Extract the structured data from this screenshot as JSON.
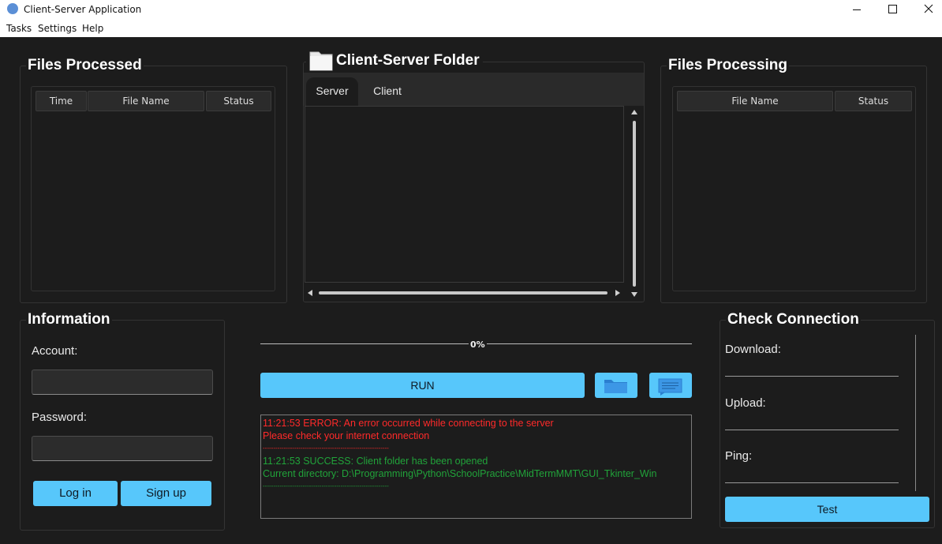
{
  "window": {
    "title": "Client-Server Application"
  },
  "menu": [
    "Tasks",
    "Settings",
    "Help"
  ],
  "files_processed": {
    "title": "Files Processed",
    "columns": [
      "Time",
      "File Name",
      "Status"
    ]
  },
  "folder": {
    "title": "Client-Server Folder",
    "tabs": [
      "Server",
      "Client"
    ],
    "active_tab": "Server"
  },
  "files_processing": {
    "title": "Files Processing",
    "columns": [
      "File Name",
      "Status"
    ]
  },
  "information": {
    "title": "Information",
    "account_label": "Account:",
    "account_value": "",
    "password_label": "Password:",
    "password_value": "",
    "login_label": "Log in",
    "signup_label": "Sign up"
  },
  "progress": {
    "value": 0,
    "label": "0%"
  },
  "actions": {
    "run_label": "RUN"
  },
  "log": {
    "lines": [
      {
        "type": "error",
        "text": "11:21:53 ERROR: An error occurred while connecting to the server"
      },
      {
        "type": "error",
        "text": "Please check your internet connection"
      },
      {
        "type": "error-sep",
        "text": "------------------------------------------------------------"
      },
      {
        "type": "success",
        "text": "11:21:53 SUCCESS: Client folder has been opened"
      },
      {
        "type": "success",
        "text": "Current directory: D:\\Programming\\Python\\SchoolPractice\\MidTermMMT\\GUI_Tkinter_Win"
      },
      {
        "type": "success-sep",
        "text": "------------------------------------------------------------"
      }
    ]
  },
  "check_connection": {
    "title": "Check Connection",
    "download_label": "Download:",
    "download_value": "",
    "upload_label": "Upload:",
    "upload_value": "",
    "ping_label": "Ping:",
    "ping_value": "",
    "test_label": "Test"
  },
  "colors": {
    "background": "#1c1c1c",
    "accent": "#57c7fb",
    "error": "#ff2a2a",
    "success": "#21a33a"
  },
  "icons": [
    "app-icon",
    "minimize-icon",
    "maximize-icon",
    "close-icon",
    "folder-icon",
    "open-folder-icon",
    "message-icon"
  ]
}
